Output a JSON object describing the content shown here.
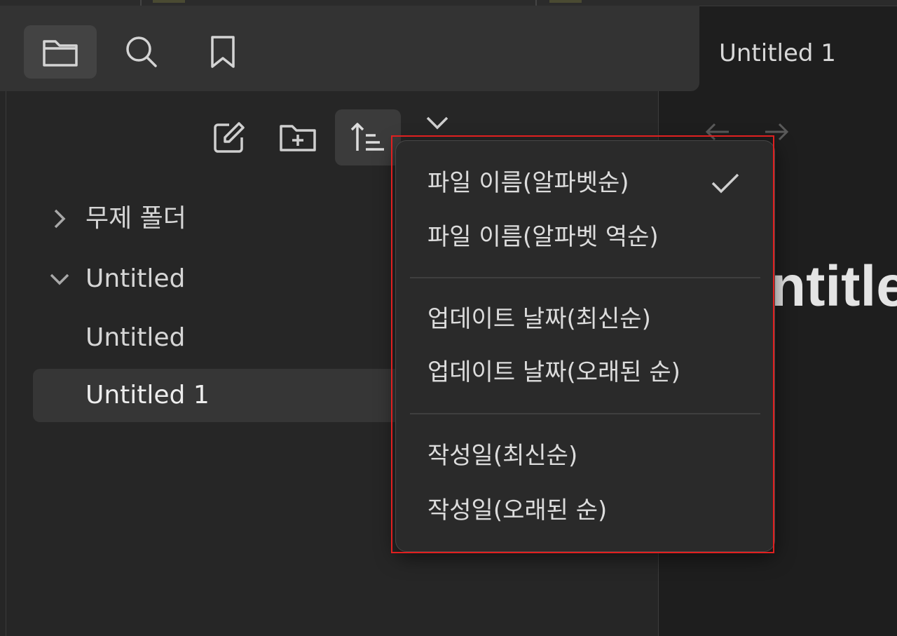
{
  "ribbon": {
    "files_icon": "folder-icon",
    "search_icon": "search-icon",
    "bookmarks_icon": "bookmark-icon"
  },
  "nav_header": {
    "new_note_icon": "edit-icon",
    "new_folder_icon": "folder-plus-icon",
    "sort_icon": "sort-ascending-icon",
    "collapse_icon": "chevron-down-icon"
  },
  "tree": {
    "items": [
      {
        "label": "무제 폴더",
        "chevron": "right"
      },
      {
        "label": "Untitled",
        "chevron": "down"
      },
      {
        "label": "Untitled"
      },
      {
        "label": "Untitled 1",
        "selected": true
      }
    ]
  },
  "tab": {
    "title": "Untitled 1"
  },
  "editor": {
    "title_partial": "ntitle"
  },
  "sort_menu": {
    "items": [
      {
        "label": "파일 이름(알파벳순)",
        "checked": true
      },
      {
        "label": "파일 이름(알파벳 역순)"
      },
      {
        "label": "업데이트 날짜(최신순)"
      },
      {
        "label": "업데이트 날짜(오래된 순)"
      },
      {
        "label": "작성일(최신순)"
      },
      {
        "label": "작성일(오래된 순)"
      }
    ]
  },
  "colors": {
    "highlight": "#e02020",
    "menu_bg": "#2a2a2a",
    "sidebar_bg": "#262626"
  }
}
